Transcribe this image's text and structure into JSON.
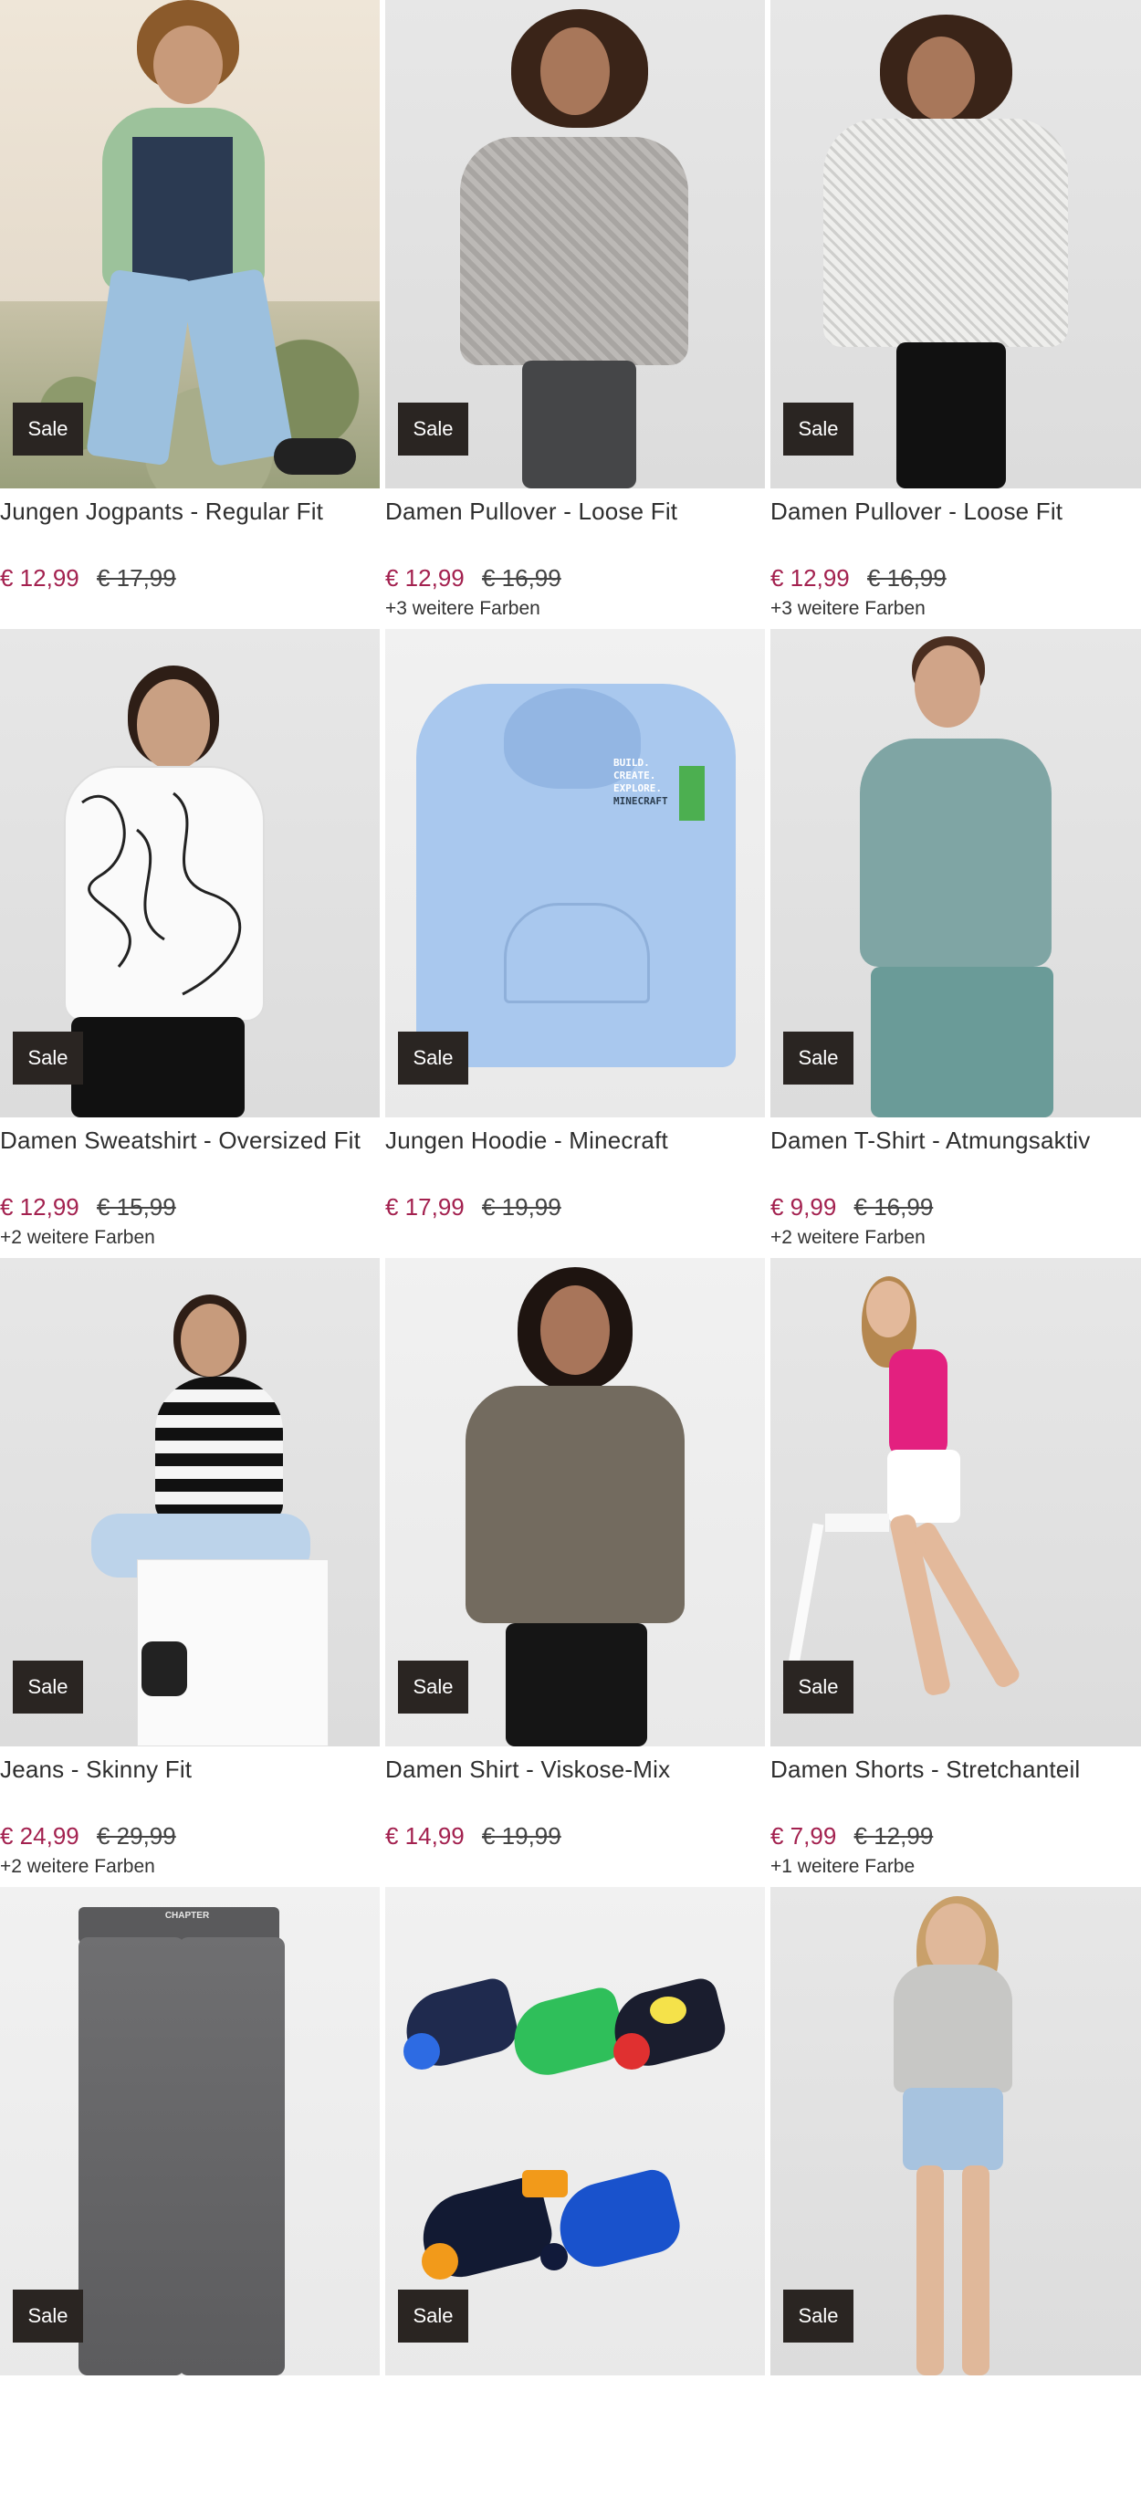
{
  "sale_label": "Sale",
  "products": [
    {
      "title": "Jungen Jogpants - Regular Fit",
      "price": "€ 12,99",
      "old_price": "€ 17,99",
      "colors": ""
    },
    {
      "title": "Damen Pullover - Loose Fit",
      "price": "€ 12,99",
      "old_price": "€ 16,99",
      "colors": "+3 weitere Farben"
    },
    {
      "title": "Damen Pullover - Loose Fit",
      "price": "€ 12,99",
      "old_price": "€ 16,99",
      "colors": "+3 weitere Farben"
    },
    {
      "title": "Damen Sweatshirt - Oversized Fit",
      "price": "€ 12,99",
      "old_price": "€ 15,99",
      "colors": "+2 weitere Farben"
    },
    {
      "title": "Jungen Hoodie - Minecraft",
      "price": "€ 17,99",
      "old_price": "€ 19,99",
      "colors": ""
    },
    {
      "title": "Damen T-Shirt - Atmungsaktiv",
      "price": "€ 9,99",
      "old_price": "€ 16,99",
      "colors": "+2 weitere Farben"
    },
    {
      "title": "Jeans - Skinny Fit",
      "price": "€ 24,99",
      "old_price": "€ 29,99",
      "colors": "+2 weitere Farben"
    },
    {
      "title": "Damen Shirt - Viskose-Mix",
      "price": "€ 14,99",
      "old_price": "€ 19,99",
      "colors": ""
    },
    {
      "title": "Damen Shorts - Stretchanteil",
      "price": "€ 7,99",
      "old_price": "€ 12,99",
      "colors": "+1 weitere Farbe"
    },
    {
      "title": "",
      "price": "",
      "old_price": "",
      "colors": ""
    },
    {
      "title": "",
      "price": "",
      "old_price": "",
      "colors": ""
    },
    {
      "title": "",
      "price": "",
      "old_price": "",
      "colors": ""
    }
  ],
  "hoodie_print": [
    "BUILD.",
    "CREATE.",
    "EXPLORE.",
    "MINECRAFT"
  ],
  "jeans_tag": "CHAPTER",
  "colors": {
    "sale_badge": "#2a2522",
    "price_now": "#a3214f"
  }
}
